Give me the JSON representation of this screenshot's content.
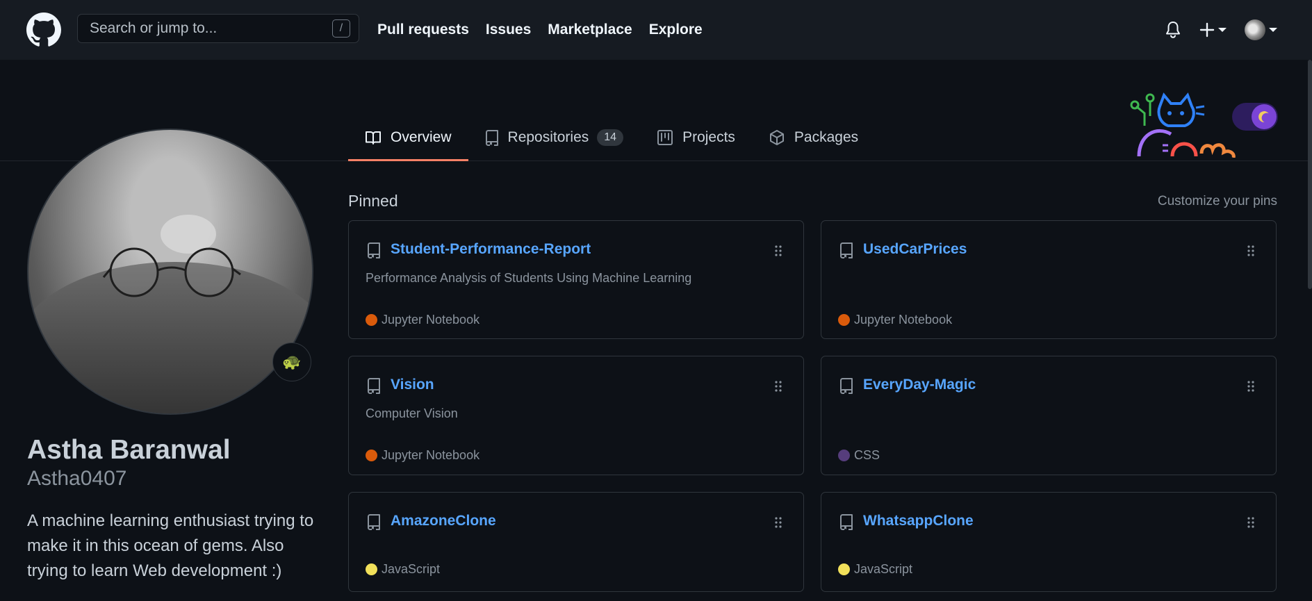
{
  "header": {
    "search_placeholder": "Search or jump to...",
    "search_shortcut": "/",
    "nav": [
      "Pull requests",
      "Issues",
      "Marketplace",
      "Explore"
    ]
  },
  "tabs": [
    {
      "label": "Overview",
      "icon": "book-icon",
      "active": true
    },
    {
      "label": "Repositories",
      "icon": "repo-icon",
      "counter": "14"
    },
    {
      "label": "Projects",
      "icon": "project-icon"
    },
    {
      "label": "Packages",
      "icon": "package-icon"
    }
  ],
  "profile": {
    "name": "Astha Baranwal",
    "username": "Astha0407",
    "status_emoji": "🐢",
    "bio": "A machine learning enthusiast trying to make it in this ocean of gems. Also trying to learn Web development :)"
  },
  "pinned": {
    "title": "Pinned",
    "customize_label": "Customize your pins",
    "repos": [
      {
        "name": "Student-Performance-Report",
        "description": "Performance Analysis of Students Using Machine Learning",
        "language": "Jupyter Notebook",
        "language_color": "#DA5B0B"
      },
      {
        "name": "UsedCarPrices",
        "description": "",
        "language": "Jupyter Notebook",
        "language_color": "#DA5B0B"
      },
      {
        "name": "Vision",
        "description": "Computer Vision",
        "language": "Jupyter Notebook",
        "language_color": "#DA5B0B"
      },
      {
        "name": "EveryDay-Magic",
        "description": "",
        "language": "CSS",
        "language_color": "#563d7c"
      },
      {
        "name": "AmazoneClone",
        "description": "",
        "language": "JavaScript",
        "language_color": "#f1e05a"
      },
      {
        "name": "WhatsappClone",
        "description": "",
        "language": "JavaScript",
        "language_color": "#f1e05a"
      }
    ]
  },
  "colors": {
    "background": "#0d1117",
    "header": "#161b22",
    "link": "#58a6ff",
    "tab_underline": "#f78166",
    "border": "#30363d"
  }
}
